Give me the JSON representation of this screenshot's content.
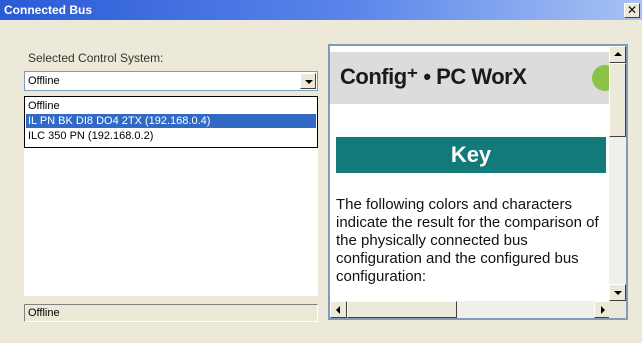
{
  "window": {
    "title": "Connected Bus",
    "close_glyph": "✕"
  },
  "selector": {
    "label": "Selected Control System:",
    "value": "Offline",
    "options": [
      "Offline",
      "IL PN BK DI8 DO4 2TX (192.168.0.4)",
      "ILC 350 PN (192.168.0.2)"
    ],
    "highlighted_index": 1
  },
  "status": {
    "text": "Offline"
  },
  "help": {
    "logo_text": "Config⁺ • PC WorX",
    "key_heading": "Key",
    "body": "The following colors and characters indicate the result for the comparison of the physically connected bus configuration and the configured bus configuration:"
  },
  "colors": {
    "title_bar": "#2a5ad6",
    "key_banner": "#127a79",
    "selection": "#316ac5",
    "logo_dot": "#8ac24a"
  }
}
